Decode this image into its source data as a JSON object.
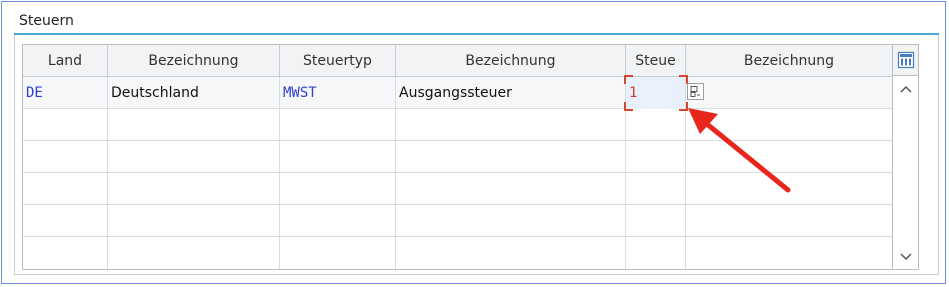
{
  "group": {
    "title": "Steuern"
  },
  "table": {
    "columns": [
      "Land",
      "Bezeichnung",
      "Steuertyp",
      "Bezeichnung",
      "Steue",
      "Bezeichnung"
    ],
    "rows": [
      {
        "land": "DE",
        "land_bez": "Deutschland",
        "steuertyp": "MWST",
        "steuertyp_bez": "Ausgangssteuer",
        "steuerklasse": "1",
        "klasse_bez": ""
      }
    ]
  },
  "icons": {
    "settings": "table-settings-icon",
    "value_help": "value-help-icon",
    "scroll_up": "chevron-up-icon",
    "scroll_down": "chevron-down-icon",
    "annotation": "red-arrow-annotation"
  },
  "colors": {
    "accent": "#4ca6cf",
    "code_text": "#2f3fd0",
    "input_value": "#d33b2b",
    "arrow": "#e8261c"
  }
}
